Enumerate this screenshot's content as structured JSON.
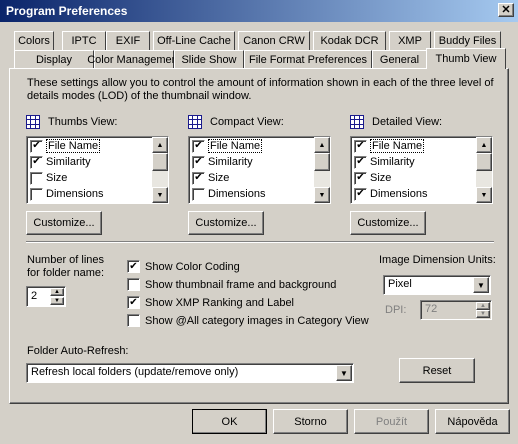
{
  "window": {
    "title": "Program Preferences",
    "close_label": "✕"
  },
  "tabs_row1": [
    "Colors",
    "IPTC",
    "EXIF",
    "Off-Line Cache",
    "Canon CRW",
    "Kodak DCR",
    "XMP",
    "Buddy Files"
  ],
  "tabs_row2": [
    "Display",
    "Color Management",
    "Slide Show",
    "File Format Preferences",
    "General",
    "Thumb View"
  ],
  "active_tab": "Thumb View",
  "intro": "These settings allow you to control the amount of information shown in each of the three level of details modes (LOD) of the thumbnail window.",
  "views": [
    {
      "title": "Thumbs View:",
      "items": [
        {
          "label": "File Name",
          "checked": true
        },
        {
          "label": "Similarity",
          "checked": true
        },
        {
          "label": "Size",
          "checked": false
        },
        {
          "label": "Dimensions",
          "checked": false
        }
      ],
      "customize": "Customize..."
    },
    {
      "title": "Compact View:",
      "items": [
        {
          "label": "File Name",
          "checked": true
        },
        {
          "label": "Similarity",
          "checked": true
        },
        {
          "label": "Size",
          "checked": true
        },
        {
          "label": "Dimensions",
          "checked": false
        }
      ],
      "customize": "Customize..."
    },
    {
      "title": "Detailed View:",
      "items": [
        {
          "label": "File Name",
          "checked": true
        },
        {
          "label": "Similarity",
          "checked": true
        },
        {
          "label": "Size",
          "checked": true
        },
        {
          "label": "Dimensions",
          "checked": true
        }
      ],
      "customize": "Customize..."
    }
  ],
  "lines": {
    "label_1": "Number of lines",
    "label_2": "for folder name:",
    "value": "2"
  },
  "options": [
    {
      "label": "Show Color Coding",
      "checked": true
    },
    {
      "label": "Show thumbnail frame and background",
      "checked": false
    },
    {
      "label": "Show XMP Ranking and Label",
      "checked": true
    },
    {
      "label": "Show @All category images in Category View",
      "checked": false
    }
  ],
  "dimension": {
    "label": "Image Dimension Units:",
    "value": "Pixel",
    "dpi_label": "DPI:",
    "dpi_value": "72"
  },
  "refresh": {
    "label": "Folder Auto-Refresh:",
    "value": "Refresh local folders (update/remove only)"
  },
  "reset_label": "Reset",
  "footer": {
    "ok": "OK",
    "cancel": "Storno",
    "apply": "Použít",
    "help": "Nápověda"
  },
  "colors": {
    "title_start": "#0a246a",
    "title_end": "#a6caf0",
    "face": "#d4d0c8",
    "grid_icon": "#1a1a8c"
  }
}
